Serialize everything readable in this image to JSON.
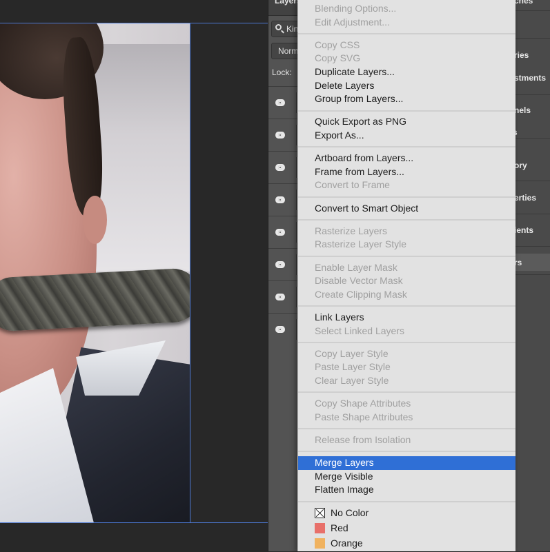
{
  "panel": {
    "title": "Layers",
    "filter_text": "Kin",
    "blend_mode": "Norm",
    "lock_label": "Lock:"
  },
  "dock": {
    "items": [
      "ches",
      "ries",
      "stments",
      "nels",
      "s",
      "ory",
      "erties",
      "ients",
      "rs"
    ],
    "active_item": "rs"
  },
  "context_menu": {
    "groups": [
      [
        {
          "label": "Blending Options...",
          "enabled": false
        },
        {
          "label": "Edit Adjustment...",
          "enabled": false
        }
      ],
      [
        {
          "label": "Copy CSS",
          "enabled": false
        },
        {
          "label": "Copy SVG",
          "enabled": false
        },
        {
          "label": "Duplicate Layers...",
          "enabled": true
        },
        {
          "label": "Delete Layers",
          "enabled": true
        },
        {
          "label": "Group from Layers...",
          "enabled": true
        }
      ],
      [
        {
          "label": "Quick Export as PNG",
          "enabled": true
        },
        {
          "label": "Export As...",
          "enabled": true
        }
      ],
      [
        {
          "label": "Artboard from Layers...",
          "enabled": true
        },
        {
          "label": "Frame from Layers...",
          "enabled": true
        },
        {
          "label": "Convert to Frame",
          "enabled": false
        }
      ],
      [
        {
          "label": "Convert to Smart Object",
          "enabled": true
        }
      ],
      [
        {
          "label": "Rasterize Layers",
          "enabled": false
        },
        {
          "label": "Rasterize Layer Style",
          "enabled": false
        }
      ],
      [
        {
          "label": "Enable Layer Mask",
          "enabled": false
        },
        {
          "label": "Disable Vector Mask",
          "enabled": false
        },
        {
          "label": "Create Clipping Mask",
          "enabled": false
        }
      ],
      [
        {
          "label": "Link Layers",
          "enabled": true
        },
        {
          "label": "Select Linked Layers",
          "enabled": false
        }
      ],
      [
        {
          "label": "Copy Layer Style",
          "enabled": false
        },
        {
          "label": "Paste Layer Style",
          "enabled": false
        },
        {
          "label": "Clear Layer Style",
          "enabled": false
        }
      ],
      [
        {
          "label": "Copy Shape Attributes",
          "enabled": false
        },
        {
          "label": "Paste Shape Attributes",
          "enabled": false
        }
      ],
      [
        {
          "label": "Release from Isolation",
          "enabled": false
        }
      ],
      [
        {
          "label": "Merge Layers",
          "enabled": true,
          "selected": true
        },
        {
          "label": "Merge Visible",
          "enabled": true
        },
        {
          "label": "Flatten Image",
          "enabled": true
        }
      ],
      [
        {
          "label": "No Color",
          "enabled": true,
          "swatch": "none"
        },
        {
          "label": "Red",
          "enabled": true,
          "swatch": "#e8706a"
        },
        {
          "label": "Orange",
          "enabled": true,
          "swatch": "#f0b25f"
        }
      ]
    ]
  },
  "colors": {
    "menu_selection": "#2f6fd6",
    "guide": "#4d7ad6"
  }
}
